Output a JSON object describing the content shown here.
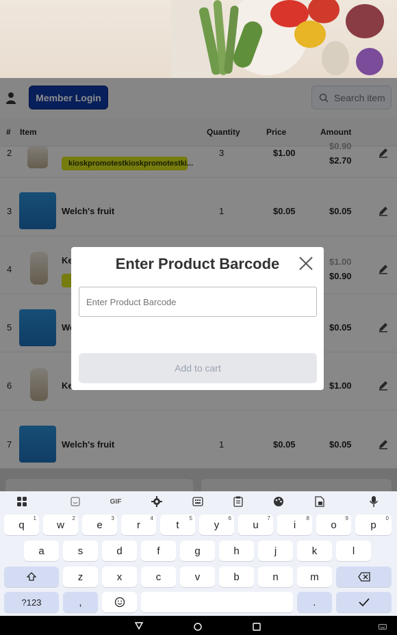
{
  "header": {
    "member_login": "Member Login",
    "search_placeholder": "Search item"
  },
  "table": {
    "headers": {
      "num": "#",
      "item": "Item",
      "quantity": "Quantity",
      "price": "Price",
      "amount": "Amount"
    },
    "rows": [
      {
        "num": "2",
        "name": "",
        "promo": "kioskpromotestkioskpromotestki...",
        "qty": "3",
        "price": "$1.00",
        "amount": "$2.70",
        "amount_top": "$0.90"
      },
      {
        "num": "3",
        "name": "Welch's fruit",
        "qty": "1",
        "price": "$0.05",
        "amount": "$0.05"
      },
      {
        "num": "4",
        "name": "Ke",
        "qty": "",
        "price": "",
        "amount": "$0.90",
        "amount_top": "$1.00"
      },
      {
        "num": "5",
        "name": "We",
        "qty": "",
        "price": "",
        "amount": "$0.05"
      },
      {
        "num": "6",
        "name": "Ke",
        "qty": "",
        "price": "",
        "amount": "$1.00"
      },
      {
        "num": "7",
        "name": "Welch's fruit",
        "qty": "1",
        "price": "$0.05",
        "amount": "$0.05"
      }
    ]
  },
  "modal": {
    "title": "Enter Product Barcode",
    "input_placeholder": "Enter Product Barcode",
    "add_button": "Add to cart"
  },
  "keyboard": {
    "row1": [
      [
        "q",
        "1"
      ],
      [
        "w",
        "2"
      ],
      [
        "e",
        "3"
      ],
      [
        "r",
        "4"
      ],
      [
        "t",
        "5"
      ],
      [
        "y",
        "6"
      ],
      [
        "u",
        "7"
      ],
      [
        "i",
        "8"
      ],
      [
        "o",
        "9"
      ],
      [
        "p",
        "0"
      ]
    ],
    "row2": [
      "a",
      "s",
      "d",
      "f",
      "g",
      "h",
      "j",
      "k",
      "l"
    ],
    "row3": [
      "z",
      "x",
      "c",
      "v",
      "b",
      "n",
      "m"
    ],
    "symbols": "?123",
    "comma": ",",
    "period": ".",
    "gif": "GIF"
  }
}
